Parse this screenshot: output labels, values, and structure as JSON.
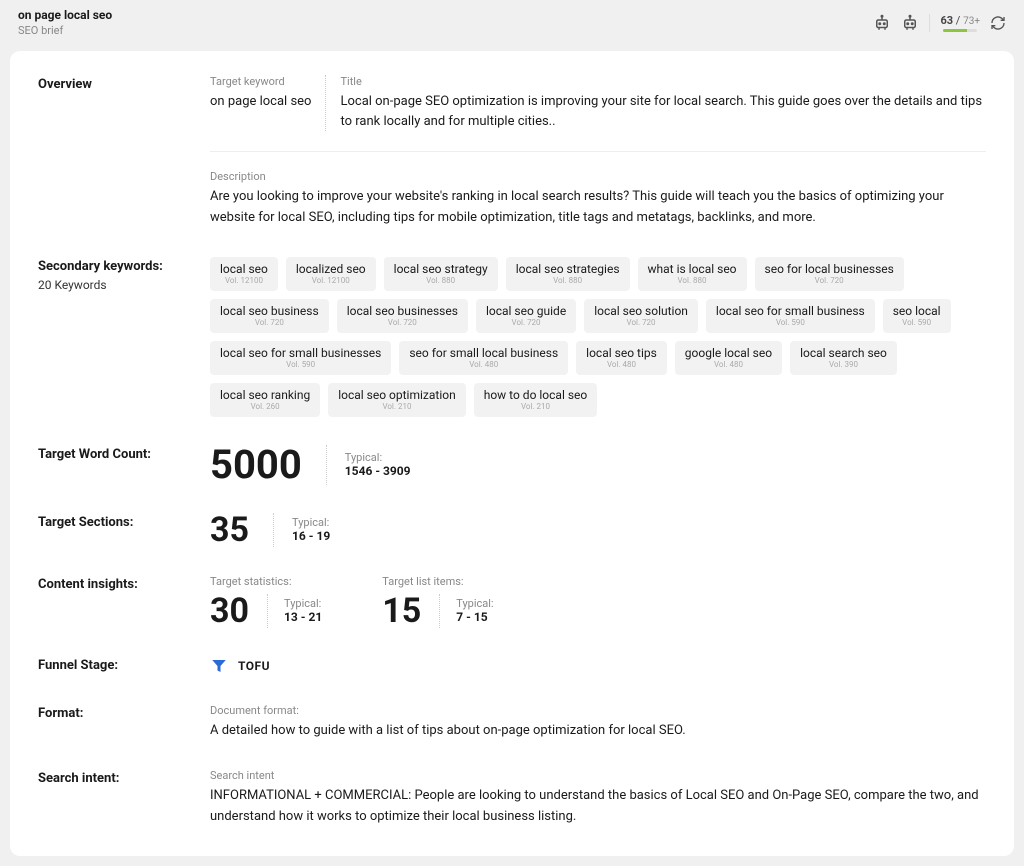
{
  "topbar": {
    "title": "on page local seo",
    "subtitle": "SEO brief",
    "score_current": "63",
    "score_target": "73+"
  },
  "overview": {
    "heading": "Overview",
    "target_keyword_label": "Target keyword",
    "target_keyword": "on page local seo",
    "title_label": "Title",
    "title_text": "Local on-page SEO optimization is improving your site for local search. This guide goes over the details and tips to rank locally and for multiple cities..",
    "description_label": "Description",
    "description_text": "Are you looking to improve your website's ranking in local search results? This guide will teach you the basics of optimizing your website for local SEO, including tips for mobile optimization, title tags and metatags, backlinks, and more."
  },
  "secondary_keywords": {
    "heading": "Secondary keywords:",
    "count_label": "20 Keywords",
    "items": [
      {
        "label": "local seo",
        "vol": "Vol. 12100"
      },
      {
        "label": "localized seo",
        "vol": "Vol. 12100"
      },
      {
        "label": "local seo strategy",
        "vol": "Vol. 880"
      },
      {
        "label": "local seo strategies",
        "vol": "Vol. 880"
      },
      {
        "label": "what is local seo",
        "vol": "Vol. 880"
      },
      {
        "label": "seo for local businesses",
        "vol": "Vol. 720"
      },
      {
        "label": "local seo business",
        "vol": "Vol. 720"
      },
      {
        "label": "local seo businesses",
        "vol": "Vol. 720"
      },
      {
        "label": "local seo guide",
        "vol": "Vol. 720"
      },
      {
        "label": "local seo solution",
        "vol": "Vol. 720"
      },
      {
        "label": "local seo for small business",
        "vol": "Vol. 590"
      },
      {
        "label": "seo local",
        "vol": "Vol. 590"
      },
      {
        "label": "local seo for small businesses",
        "vol": "Vol. 590"
      },
      {
        "label": "seo for small local business",
        "vol": "Vol. 480"
      },
      {
        "label": "local seo tips",
        "vol": "Vol. 480"
      },
      {
        "label": "google local seo",
        "vol": "Vol. 480"
      },
      {
        "label": "local search seo",
        "vol": "Vol. 390"
      },
      {
        "label": "local seo ranking",
        "vol": "Vol. 260"
      },
      {
        "label": "local seo optimization",
        "vol": "Vol. 210"
      },
      {
        "label": "how to do local seo",
        "vol": "Vol. 210"
      }
    ]
  },
  "target_word_count": {
    "heading": "Target Word Count:",
    "value": "5000",
    "typical_label": "Typical:",
    "typical_range": "1546 - 3909"
  },
  "target_sections": {
    "heading": "Target Sections:",
    "value": "35",
    "typical_label": "Typical:",
    "typical_range": "16 - 19"
  },
  "content_insights": {
    "heading": "Content insights:",
    "target_statistics_label": "Target statistics:",
    "target_statistics_value": "30",
    "target_statistics_typical_label": "Typical:",
    "target_statistics_typical_range": "13 - 21",
    "target_list_items_label": "Target list items:",
    "target_list_items_value": "15",
    "target_list_items_typical_label": "Typical:",
    "target_list_items_typical_range": "7 - 15"
  },
  "funnel_stage": {
    "heading": "Funnel Stage:",
    "value": "TOFU"
  },
  "format": {
    "heading": "Format:",
    "sub_label": "Document format:",
    "text": "A detailed how to guide with a list of tips about on-page optimization for local SEO."
  },
  "search_intent": {
    "heading": "Search intent:",
    "sub_label": "Search intent",
    "text": "INFORMATIONAL + COMMERCIAL: People are looking to understand the basics of Local SEO and On-Page SEO, compare the two, and understand how it works to optimize their local business listing."
  }
}
